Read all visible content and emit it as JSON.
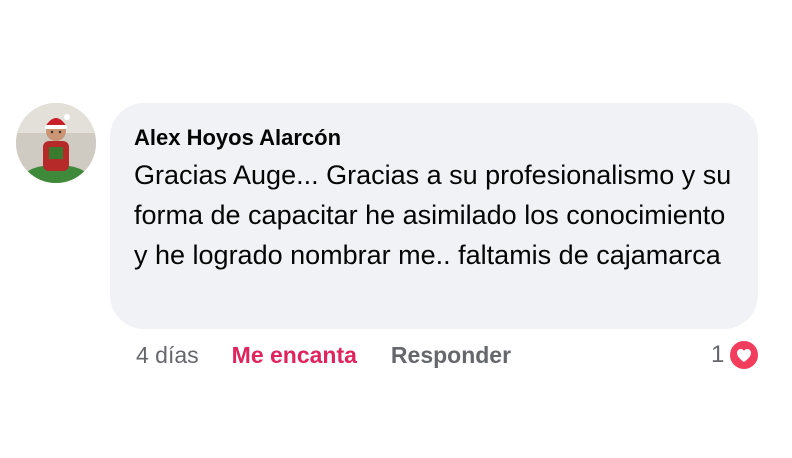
{
  "comment": {
    "author": "Alex Hoyos Alarcón",
    "avatar_icon": "profile-photo-child-santa-hat",
    "text": "Gracias Auge... Gracias a su profesionalismo y su forma de capacitar he asimilado los conocimiento y he logrado nombrar me.. faltamis de cajamarca"
  },
  "actions": {
    "time": "4 días",
    "love_label": "Me encanta",
    "reply_label": "Responder"
  },
  "reactions": {
    "count": "1",
    "icon": "heart-icon",
    "color": "#f23e5c"
  },
  "colors": {
    "bubble": "#f0f2f5",
    "love_accent": "#e0245e",
    "muted": "#65676b"
  }
}
